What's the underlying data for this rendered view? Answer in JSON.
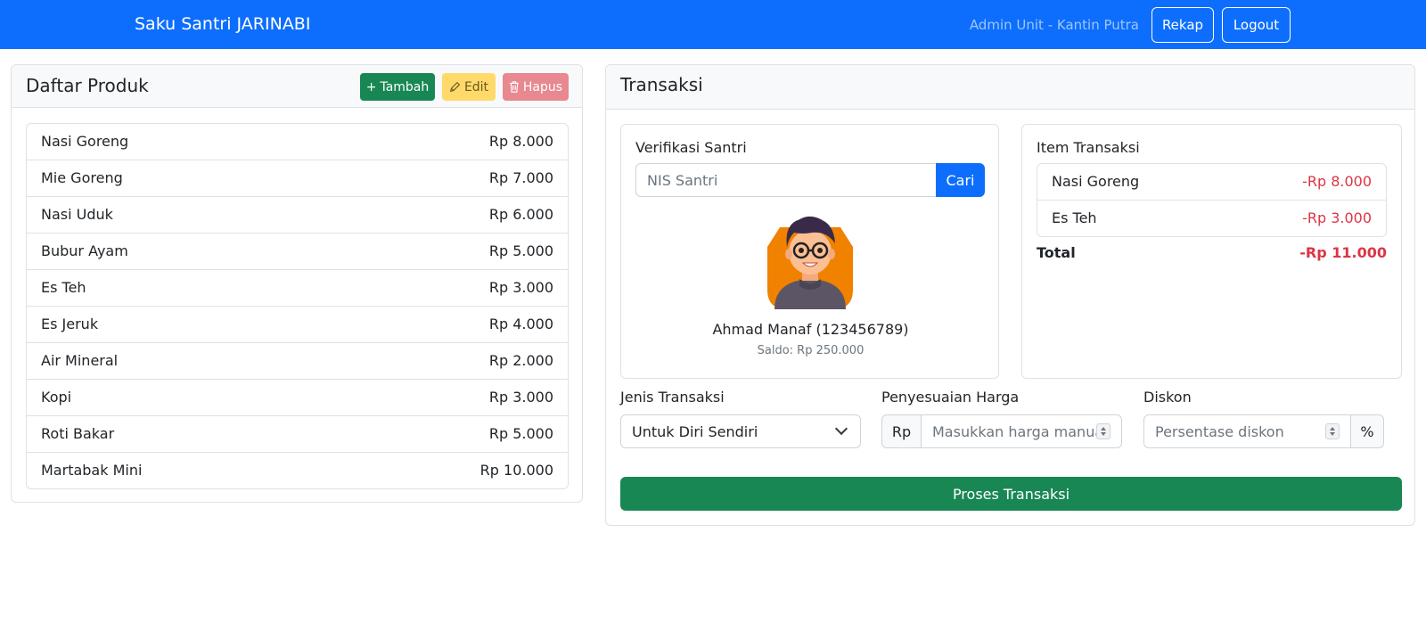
{
  "navbar": {
    "brand": "Saku Santri JARINABI",
    "user_label": "Admin Unit - Kantin Putra",
    "rekap_label": "Rekap",
    "logout_label": "Logout"
  },
  "products": {
    "title": "Daftar Produk",
    "add_label": "Tambah",
    "edit_label": "Edit",
    "delete_label": "Hapus",
    "items": [
      {
        "name": "Nasi Goreng",
        "price": "Rp 8.000"
      },
      {
        "name": "Mie Goreng",
        "price": "Rp 7.000"
      },
      {
        "name": "Nasi Uduk",
        "price": "Rp 6.000"
      },
      {
        "name": "Bubur Ayam",
        "price": "Rp 5.000"
      },
      {
        "name": "Es Teh",
        "price": "Rp 3.000"
      },
      {
        "name": "Es Jeruk",
        "price": "Rp 4.000"
      },
      {
        "name": "Air Mineral",
        "price": "Rp 2.000"
      },
      {
        "name": "Kopi",
        "price": "Rp 3.000"
      },
      {
        "name": "Roti Bakar",
        "price": "Rp 5.000"
      },
      {
        "name": "Martabak Mini",
        "price": "Rp 10.000"
      }
    ]
  },
  "transaction": {
    "title": "Transaksi",
    "verification": {
      "title": "Verifikasi Santri",
      "nis_placeholder": "NIS Santri",
      "search_label": "Cari",
      "student_name": "Ahmad Manaf (123456789)",
      "balance": "Saldo: Rp 250.000"
    },
    "items": {
      "title": "Item Transaksi",
      "rows": [
        {
          "name": "Nasi Goreng",
          "price": "-Rp 8.000"
        },
        {
          "name": "Es Teh",
          "price": "-Rp 3.000"
        }
      ],
      "total_label": "Total",
      "total_value": "-Rp 11.000"
    },
    "type_label": "Jenis Transaksi",
    "type_value": "Untuk Diri Sendiri",
    "price_adjust_label": "Penyesuaian Harga",
    "price_prefix": "Rp",
    "price_placeholder": "Masukkan harga manual",
    "discount_label": "Diskon",
    "discount_placeholder": "Persentase diskon",
    "discount_suffix": "%",
    "process_label": "Proses Transaksi"
  },
  "colors": {
    "primary": "#0d6efd",
    "success": "#198754",
    "warning": "#ffc107",
    "danger": "#dc3545"
  }
}
